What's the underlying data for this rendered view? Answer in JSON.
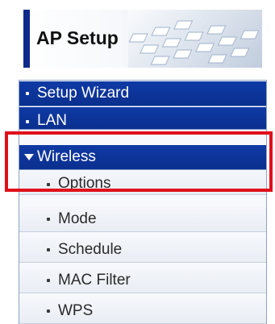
{
  "banner": {
    "title": "AP Setup"
  },
  "menu": {
    "items": [
      {
        "label": "Setup Wizard",
        "type": "main"
      },
      {
        "label": "LAN",
        "type": "main"
      },
      {
        "label": "Wireless",
        "type": "main",
        "expanded": true
      },
      {
        "label": "Options",
        "type": "sub"
      },
      {
        "label": "Mode",
        "type": "sub"
      },
      {
        "label": "Schedule",
        "type": "sub"
      },
      {
        "label": "MAC Filter",
        "type": "sub"
      },
      {
        "label": "WPS",
        "type": "sub"
      }
    ]
  },
  "colors": {
    "main_item_bg": "#0a2f8e",
    "sub_item_bg": "#eef1f6",
    "highlight": "#e0101a",
    "banner_accent": "#0e2a8a"
  },
  "icons": {
    "bullet": "square-bullet-icon",
    "expand": "triangle-down-icon"
  }
}
